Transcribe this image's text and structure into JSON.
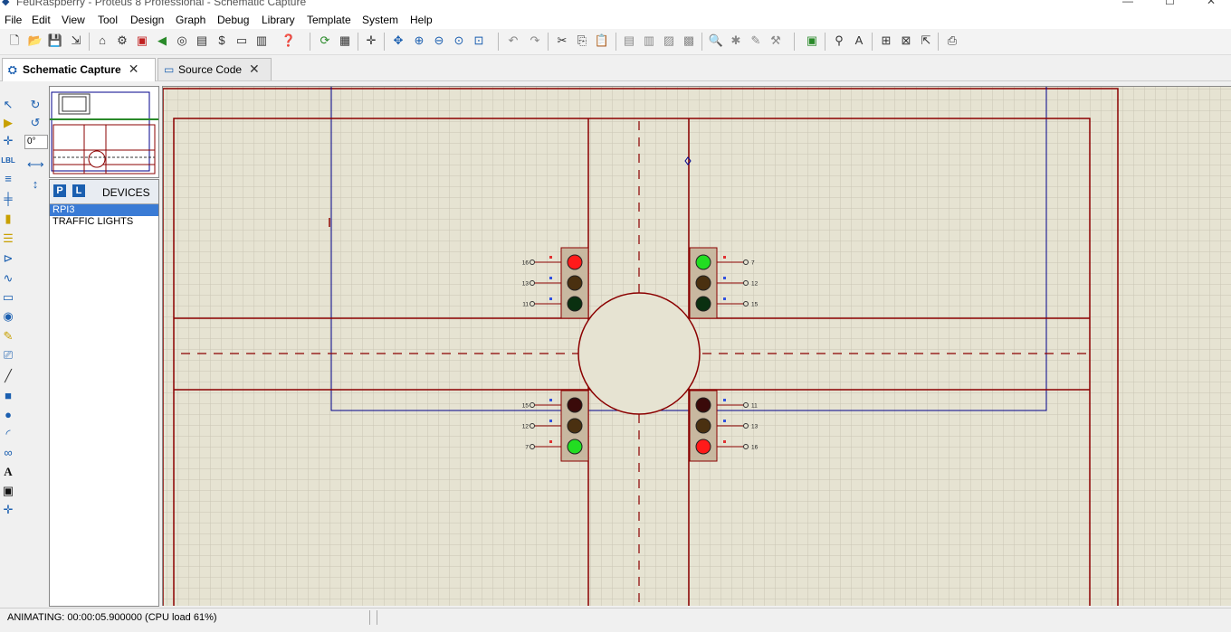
{
  "window": {
    "title": "FeuRaspberry - Proteus 8 Professional - Schematic Capture"
  },
  "menu": [
    "File",
    "Edit",
    "View",
    "Tool",
    "Design",
    "Graph",
    "Debug",
    "Library",
    "Template",
    "System",
    "Help"
  ],
  "tabs": [
    {
      "label": "Schematic Capture",
      "active": true
    },
    {
      "label": "Source Code",
      "active": false
    }
  ],
  "rotation": {
    "value": "0°"
  },
  "devices": {
    "p_label": "P",
    "l_label": "L",
    "title": "DEVICES",
    "items": [
      {
        "label": "RPI3",
        "selected": true
      },
      {
        "label": "TRAFFIC LIGHTS",
        "selected": false
      }
    ]
  },
  "traffic_lights": [
    {
      "id": "top-left",
      "pins": [
        "16",
        "13",
        "11"
      ],
      "lamps": [
        "red",
        "off",
        "off"
      ]
    },
    {
      "id": "top-right",
      "pins": [
        "7",
        "12",
        "15"
      ],
      "lamps": [
        "green",
        "off",
        "off"
      ]
    },
    {
      "id": "bottom-left",
      "pins": [
        "15",
        "12",
        "7"
      ],
      "lamps": [
        "off",
        "off",
        "green"
      ]
    },
    {
      "id": "bottom-right",
      "pins": [
        "11",
        "13",
        "16"
      ],
      "lamps": [
        "off",
        "off",
        "red"
      ]
    }
  ],
  "colors": {
    "canvas_bg": "#e6e3d2",
    "wire": "#8b0000",
    "sheet": "#00008b",
    "lamp_red_on": "#ff1a1a",
    "lamp_green_on": "#22dd22",
    "lamp_off_red": "#3a0a0a",
    "lamp_off_amber": "#4a3010",
    "lamp_off_green": "#0a3010"
  },
  "status": {
    "text": "ANIMATING: 00:00:05.900000 (CPU load 61%)"
  }
}
